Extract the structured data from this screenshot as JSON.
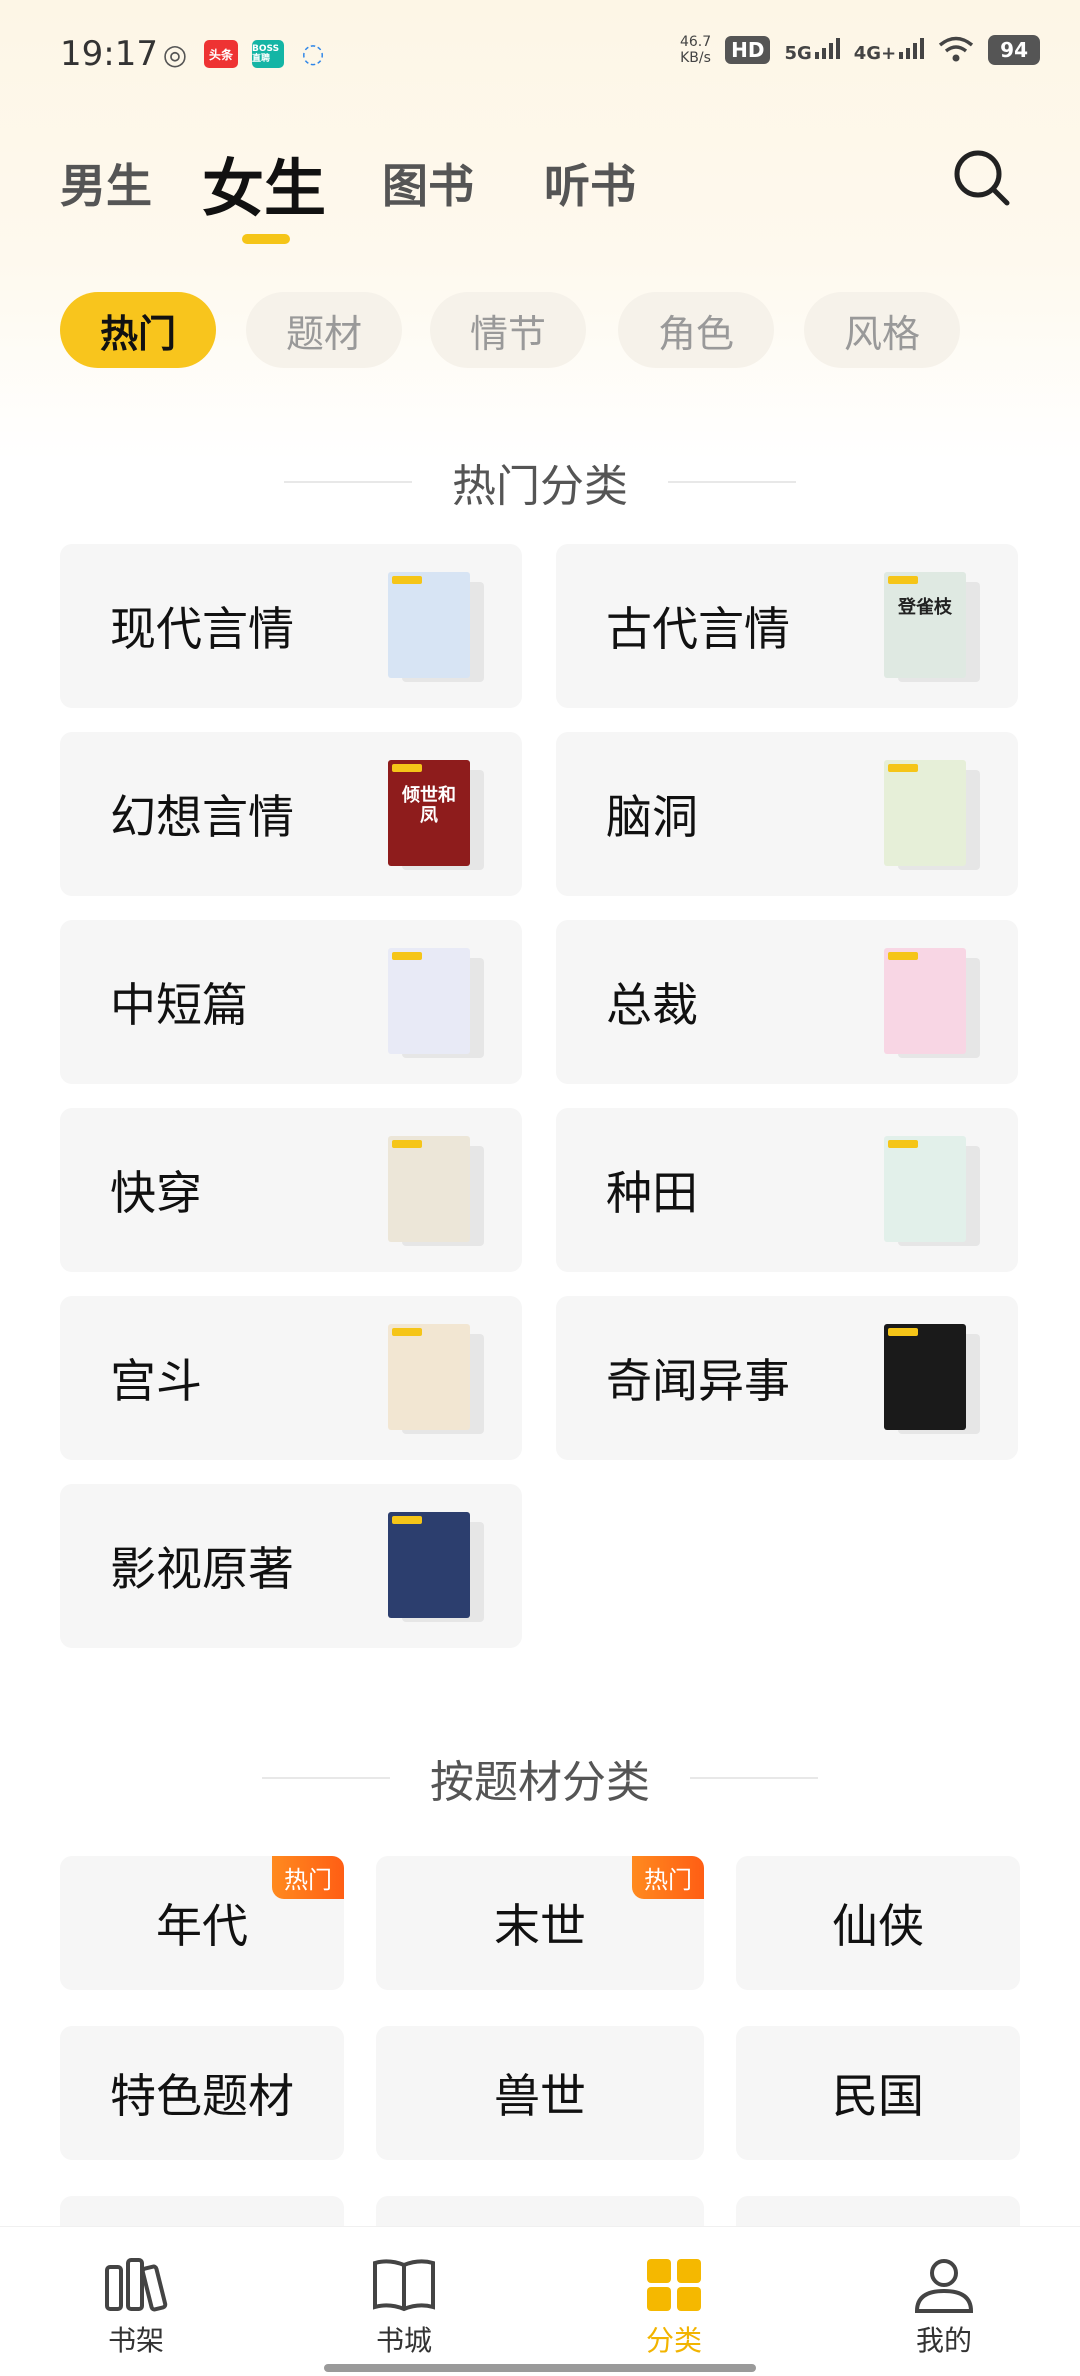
{
  "status_bar": {
    "time": "19:17",
    "net_speed_value": "46.7",
    "net_speed_unit": "KB/s",
    "hd_label": "HD",
    "signal1": "5G",
    "signal2": "4G+",
    "battery": "94",
    "app_icons": [
      "wechat-icon",
      "toutiao-icon",
      "boss-zhipin-icon",
      "message-icon"
    ],
    "toutiao_text": "头条",
    "boss_text": "BOSS直聘"
  },
  "tabs": [
    {
      "label": "男生",
      "active": false
    },
    {
      "label": "女生",
      "active": true
    },
    {
      "label": "图书",
      "active": false
    },
    {
      "label": "听书",
      "active": false
    }
  ],
  "chips": [
    {
      "label": "热门",
      "active": true
    },
    {
      "label": "题材",
      "active": false
    },
    {
      "label": "情节",
      "active": false
    },
    {
      "label": "角色",
      "active": false
    },
    {
      "label": "风格",
      "active": false
    }
  ],
  "hot_section": {
    "title": "热门分类",
    "categories": [
      {
        "label": "现代言情",
        "cover_title": "",
        "cover_bg": "#d7e4f4",
        "cover_fg": "#6a5da8"
      },
      {
        "label": "古代言情",
        "cover_title": "登雀枝",
        "cover_bg": "#dfe9e2",
        "cover_fg": "#222"
      },
      {
        "label": "幻想言情",
        "cover_title": "倾世和凤",
        "cover_bg": "#8e1c1c",
        "cover_fg": "#fff"
      },
      {
        "label": "脑洞",
        "cover_title": "",
        "cover_bg": "#e6efd8",
        "cover_fg": "#3a6a2e"
      },
      {
        "label": "中短篇",
        "cover_title": "",
        "cover_bg": "#e8eaf6",
        "cover_fg": "#5a4f9e"
      },
      {
        "label": "总裁",
        "cover_title": "",
        "cover_bg": "#f8d6e4",
        "cover_fg": "#c0457a"
      },
      {
        "label": "快穿",
        "cover_title": "",
        "cover_bg": "#ece6d8",
        "cover_fg": "#333"
      },
      {
        "label": "种田",
        "cover_title": "",
        "cover_bg": "#e2f0ea",
        "cover_fg": "#2a4a3a"
      },
      {
        "label": "宫斗",
        "cover_title": "",
        "cover_bg": "#f2e6d2",
        "cover_fg": "#7a3b1a"
      },
      {
        "label": "奇闻异事",
        "cover_title": "",
        "cover_bg": "#1a1a1a",
        "cover_fg": "#eee"
      },
      {
        "label": "影视原著",
        "cover_title": "",
        "cover_bg": "#2c3e6e",
        "cover_fg": "#e6d8a8"
      }
    ]
  },
  "theme_section": {
    "title": "按题材分类",
    "themes": [
      {
        "label": "年代",
        "badge": "热门"
      },
      {
        "label": "末世",
        "badge": "热门"
      },
      {
        "label": "仙侠",
        "badge": ""
      },
      {
        "label": "特色题材",
        "badge": ""
      },
      {
        "label": "兽世",
        "badge": ""
      },
      {
        "label": "民国",
        "badge": ""
      }
    ]
  },
  "bottom_nav": [
    {
      "label": "书架",
      "icon": "bookshelf-icon",
      "active": false
    },
    {
      "label": "书城",
      "icon": "open-book-icon",
      "active": false
    },
    {
      "label": "分类",
      "icon": "category-grid-icon",
      "active": true
    },
    {
      "label": "我的",
      "icon": "profile-icon",
      "active": false
    }
  ],
  "colors": {
    "accent": "#f8c51d",
    "active_nav": "#f2b400",
    "hot_badge": "#ff6a17",
    "card_bg": "#f6f6f6"
  }
}
